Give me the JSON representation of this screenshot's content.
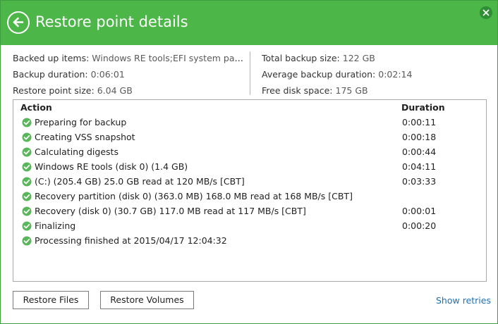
{
  "colors": {
    "accent": "#4cb648",
    "success": "#5ab65a",
    "link": "#1e6fb5"
  },
  "header": {
    "title": "Restore point details",
    "back_icon": "back-arrow-icon",
    "close_icon": "close-icon"
  },
  "info_left": [
    {
      "label": "Backed up items:",
      "value": "Windows RE tools;EFI system parti..."
    },
    {
      "label": "Backup duration:",
      "value": "0:06:01"
    },
    {
      "label": "Restore point size:",
      "value": "6.04 GB"
    }
  ],
  "info_right": [
    {
      "label": "Total backup size:",
      "value": "122 GB"
    },
    {
      "label": "Average backup duration:",
      "value": "0:02:14"
    },
    {
      "label": "Free disk space:",
      "value": "175 GB"
    }
  ],
  "table": {
    "headers": {
      "action": "Action",
      "duration": "Duration"
    },
    "rows": [
      {
        "action": "Preparing for backup",
        "duration": "0:00:11"
      },
      {
        "action": "Creating VSS snapshot",
        "duration": "0:00:18"
      },
      {
        "action": "Calculating digests",
        "duration": "0:00:44"
      },
      {
        "action": "Windows RE tools (disk 0) (1.4 GB)",
        "duration": "0:04:11"
      },
      {
        "action": " (C:) (205.4 GB) 25.0 GB read at 120 MB/s [CBT]",
        "duration": "0:03:33"
      },
      {
        "action": "Recovery partition (disk 0) (363.0 MB) 168.0 MB read at 168 MB/s [CBT]",
        "duration": ""
      },
      {
        "action": "Recovery (disk 0) (30.7 GB) 117.0 MB read at 117 MB/s [CBT]",
        "duration": "0:00:01"
      },
      {
        "action": "Finalizing",
        "duration": "0:00:20"
      },
      {
        "action": "Processing finished at 2015/04/17 12:04:32",
        "duration": ""
      }
    ]
  },
  "footer": {
    "restore_files": "Restore Files",
    "restore_volumes": "Restore Volumes",
    "show_retries": "Show retries"
  }
}
